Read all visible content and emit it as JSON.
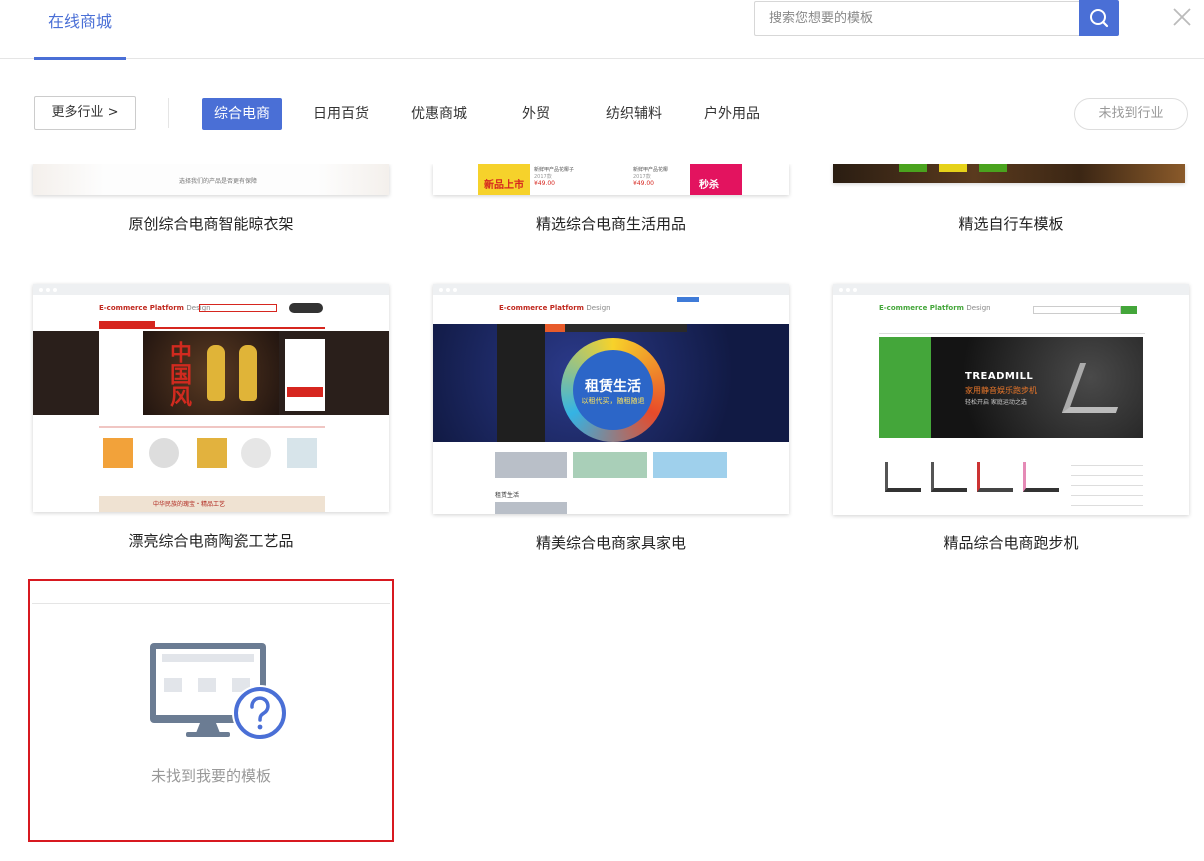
{
  "header": {
    "active_tab": "在线商城",
    "search_placeholder": "搜索您想要的模板"
  },
  "categories": {
    "more_label": "更多行业 >",
    "items": [
      "综合电商",
      "日用百货",
      "优惠商城",
      "外贸",
      "纺织辅料",
      "户外用品"
    ],
    "active_index": 0,
    "not_found_label": "未找到行业"
  },
  "templates": [
    {
      "title": "原创综合电商智能晾衣架",
      "caption": "选择我们的产品是否更有保障"
    },
    {
      "title": "精选综合电商生活用品",
      "item1_name": "新鲜甲产品花椰子",
      "item1_sub": "2017款",
      "item1_price": "¥49.00",
      "item2_name": "新鲜甲产品花椰",
      "item2_sub": "2017款",
      "item2_price": "¥49.00",
      "promo1": "新品上市",
      "promo2": "秒杀"
    },
    {
      "title": "精选自行车模板"
    },
    {
      "title": "漂亮综合电商陶瓷工艺品",
      "logo": "E-commerce Platform",
      "logo_sub": "Design",
      "hero_text": "中国风",
      "banner_text": "中华民族的瑰宝・精品工艺"
    },
    {
      "title": "精美综合电商家具家电",
      "logo": "E-commerce Platform",
      "logo_sub": "Design",
      "hero_line1": "租赁生活",
      "hero_line2": "以租代买，随租随退",
      "section": "租赁生活"
    },
    {
      "title": "精品综合电商跑步机",
      "logo": "E-commerce Platform",
      "logo_sub": "Design",
      "hero_title": "TREADMILL",
      "hero_sub": "家用静音娱乐跑步机",
      "hero_sub2": "轻松开启 家庭运动之选"
    }
  ],
  "custom_card": {
    "label": "未找到我要的模板"
  },
  "colors": {
    "accent": "#4a6fd6",
    "highlight_border": "#d71920"
  }
}
